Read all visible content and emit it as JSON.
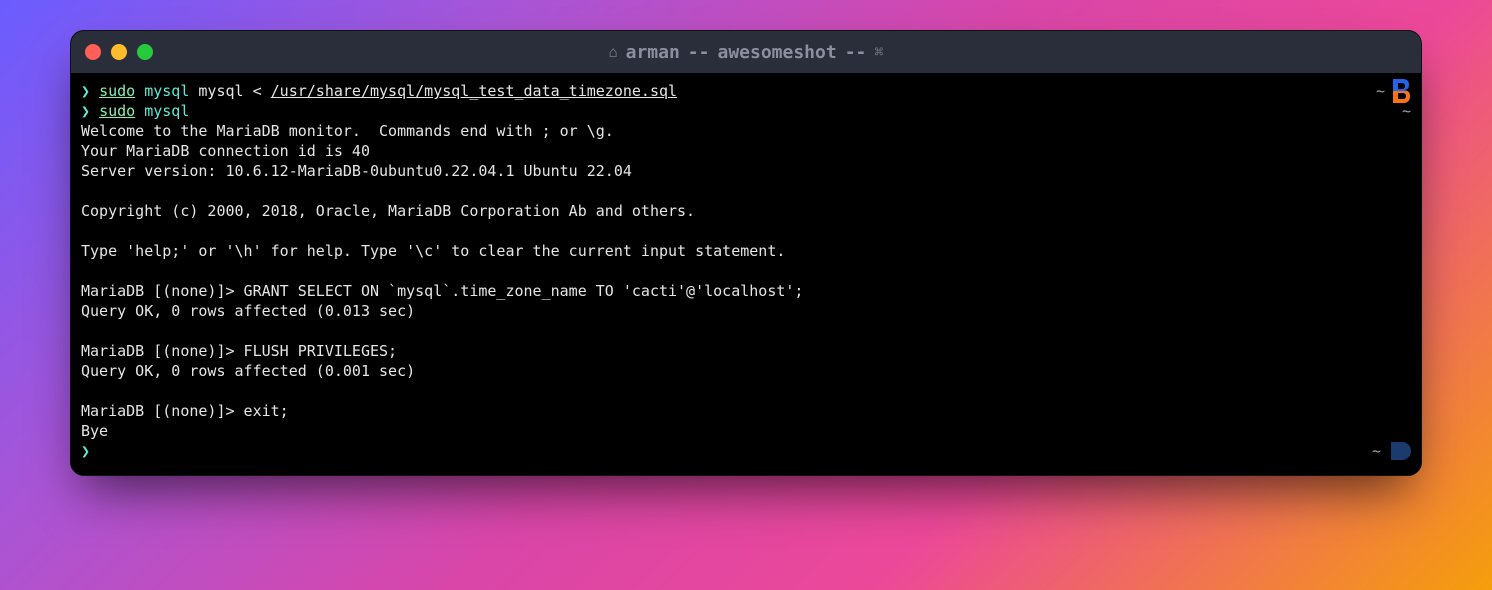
{
  "window": {
    "title_user": "arman",
    "title_sep1": "--",
    "title_app": "awesomeshot",
    "title_sep2": "--"
  },
  "p1": {
    "caret": "❯",
    "sudo": "sudo",
    "cmd": "mysql",
    "arg1": "mysql",
    "lt": "<",
    "path": "/usr/share/mysql/mysql_test_data_timezone.sql"
  },
  "p2": {
    "caret": "❯",
    "sudo": "sudo",
    "cmd": "mysql"
  },
  "out": {
    "l1": "Welcome to the MariaDB monitor.  Commands end with ; or \\g.",
    "l2": "Your MariaDB connection id is 40",
    "l3": "Server version: 10.6.12-MariaDB-0ubuntu0.22.04.1 Ubuntu 22.04",
    "l4": "Copyright (c) 2000, 2018, Oracle, MariaDB Corporation Ab and others.",
    "l5": "Type 'help;' or '\\h' for help. Type '\\c' to clear the current input statement.",
    "l6": "MariaDB [(none)]> GRANT SELECT ON `mysql`.time_zone_name TO 'cacti'@'localhost';",
    "l7": "Query OK, 0 rows affected (0.013 sec)",
    "l8": "MariaDB [(none)]> FLUSH PRIVILEGES;",
    "l9": "Query OK, 0 rows affected (0.001 sec)",
    "l10": "MariaDB [(none)]> exit;",
    "l11": "Bye"
  },
  "p3": {
    "caret": "❯"
  },
  "gutter": {
    "t1": "~",
    "t2": "~",
    "tb": "~"
  }
}
